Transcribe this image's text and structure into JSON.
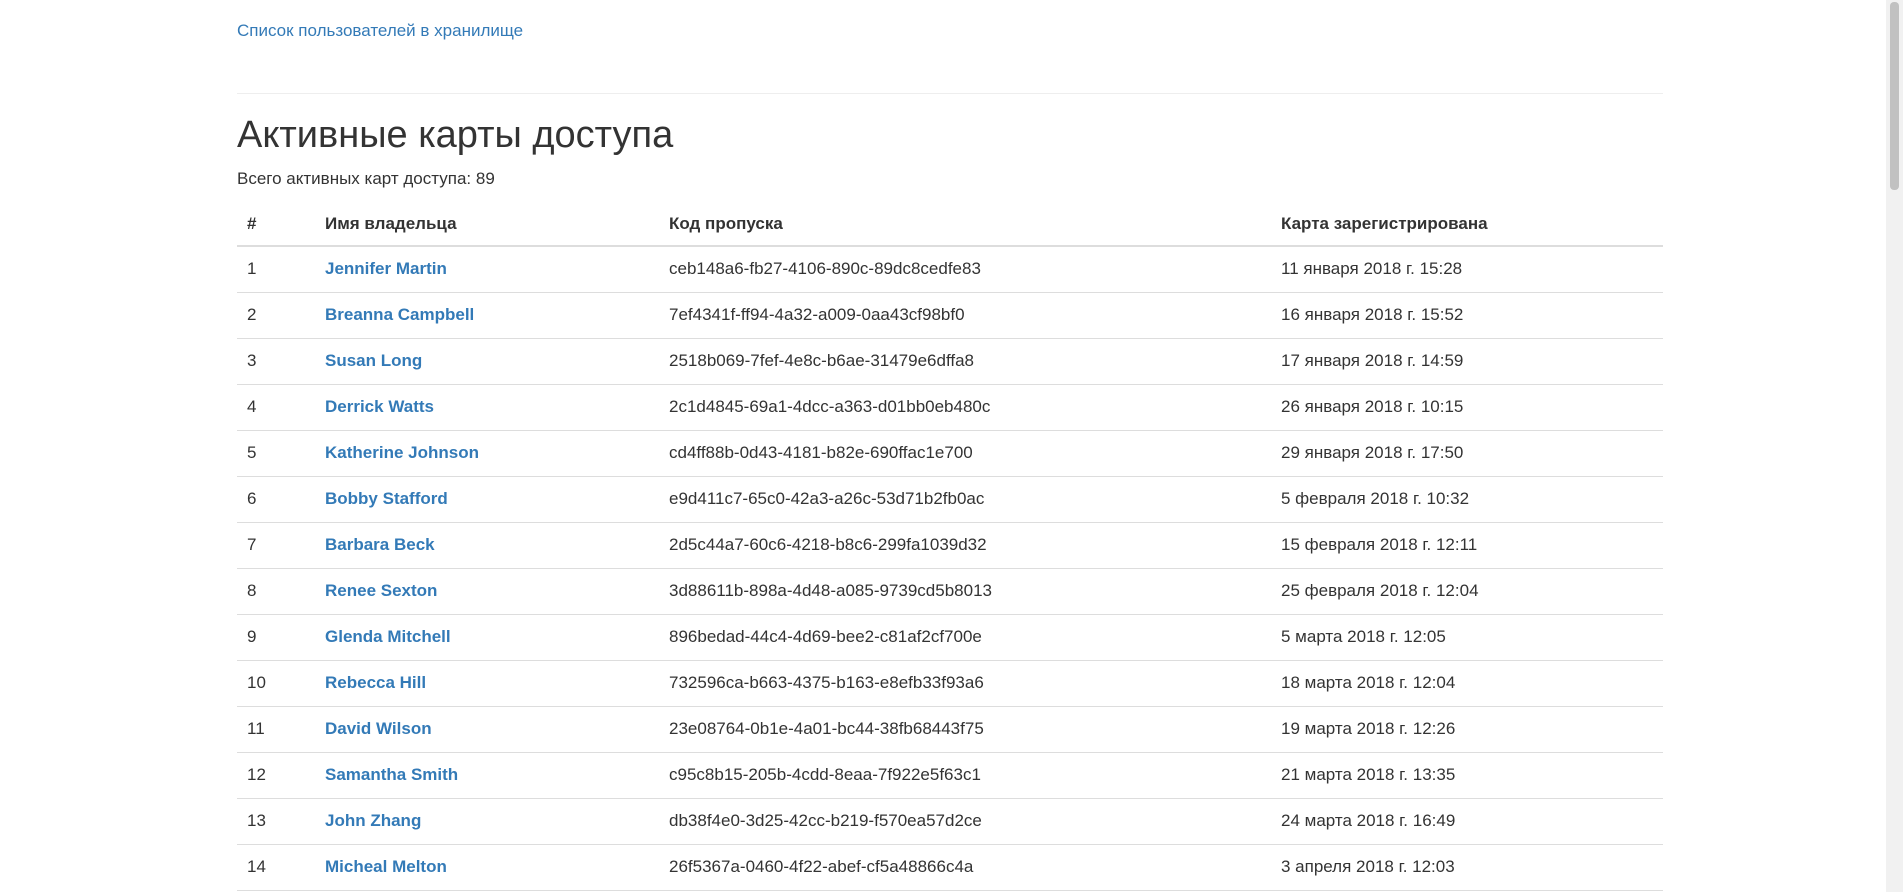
{
  "nav": {
    "storage_users_link": "Список пользователей в хранилище"
  },
  "header": {
    "title": "Активные карты доступа",
    "summary_label": "Всего активных карт доступа:",
    "summary_count": "89"
  },
  "table": {
    "columns": [
      "#",
      "Имя владельца",
      "Код пропуска",
      "Карта зарегистрирована"
    ],
    "rows": [
      {
        "num": "1",
        "owner": "Jennifer Martin",
        "code": "ceb148a6-fb27-4106-890c-89dc8cedfe83",
        "registered": "11 января 2018 г. 15:28"
      },
      {
        "num": "2",
        "owner": "Breanna Campbell",
        "code": "7ef4341f-ff94-4a32-a009-0aa43cf98bf0",
        "registered": "16 января 2018 г. 15:52"
      },
      {
        "num": "3",
        "owner": "Susan Long",
        "code": "2518b069-7fef-4e8c-b6ae-31479e6dffa8",
        "registered": "17 января 2018 г. 14:59"
      },
      {
        "num": "4",
        "owner": "Derrick Watts",
        "code": "2c1d4845-69a1-4dcc-a363-d01bb0eb480c",
        "registered": "26 января 2018 г. 10:15"
      },
      {
        "num": "5",
        "owner": "Katherine Johnson",
        "code": "cd4ff88b-0d43-4181-b82e-690ffac1e700",
        "registered": "29 января 2018 г. 17:50"
      },
      {
        "num": "6",
        "owner": "Bobby Stafford",
        "code": "e9d411c7-65c0-42a3-a26c-53d71b2fb0ac",
        "registered": "5 февраля 2018 г. 10:32"
      },
      {
        "num": "7",
        "owner": "Barbara Beck",
        "code": "2d5c44a7-60c6-4218-b8c6-299fa1039d32",
        "registered": "15 февраля 2018 г. 12:11"
      },
      {
        "num": "8",
        "owner": "Renee Sexton",
        "code": "3d88611b-898a-4d48-a085-9739cd5b8013",
        "registered": "25 февраля 2018 г. 12:04"
      },
      {
        "num": "9",
        "owner": "Glenda Mitchell",
        "code": "896bedad-44c4-4d69-bee2-c81af2cf700e",
        "registered": "5 марта 2018 г. 12:05"
      },
      {
        "num": "10",
        "owner": "Rebecca Hill",
        "code": "732596ca-b663-4375-b163-e8efb33f93a6",
        "registered": "18 марта 2018 г. 12:04"
      },
      {
        "num": "11",
        "owner": "David Wilson",
        "code": "23e08764-0b1e-4a01-bc44-38fb68443f75",
        "registered": "19 марта 2018 г. 12:26"
      },
      {
        "num": "12",
        "owner": "Samantha Smith",
        "code": "c95c8b15-205b-4cdd-8eaa-7f922e5f63c1",
        "registered": "21 марта 2018 г. 13:35"
      },
      {
        "num": "13",
        "owner": "John Zhang",
        "code": "db38f4e0-3d25-42cc-b219-f570ea57d2ce",
        "registered": "24 марта 2018 г. 16:49"
      },
      {
        "num": "14",
        "owner": "Micheal Melton",
        "code": "26f5367a-0460-4f22-abef-cf5a48866c4a",
        "registered": "3 апреля 2018 г. 12:03"
      }
    ]
  },
  "colors": {
    "link": "#337ab7",
    "text": "#333333",
    "border": "#dddddd"
  }
}
